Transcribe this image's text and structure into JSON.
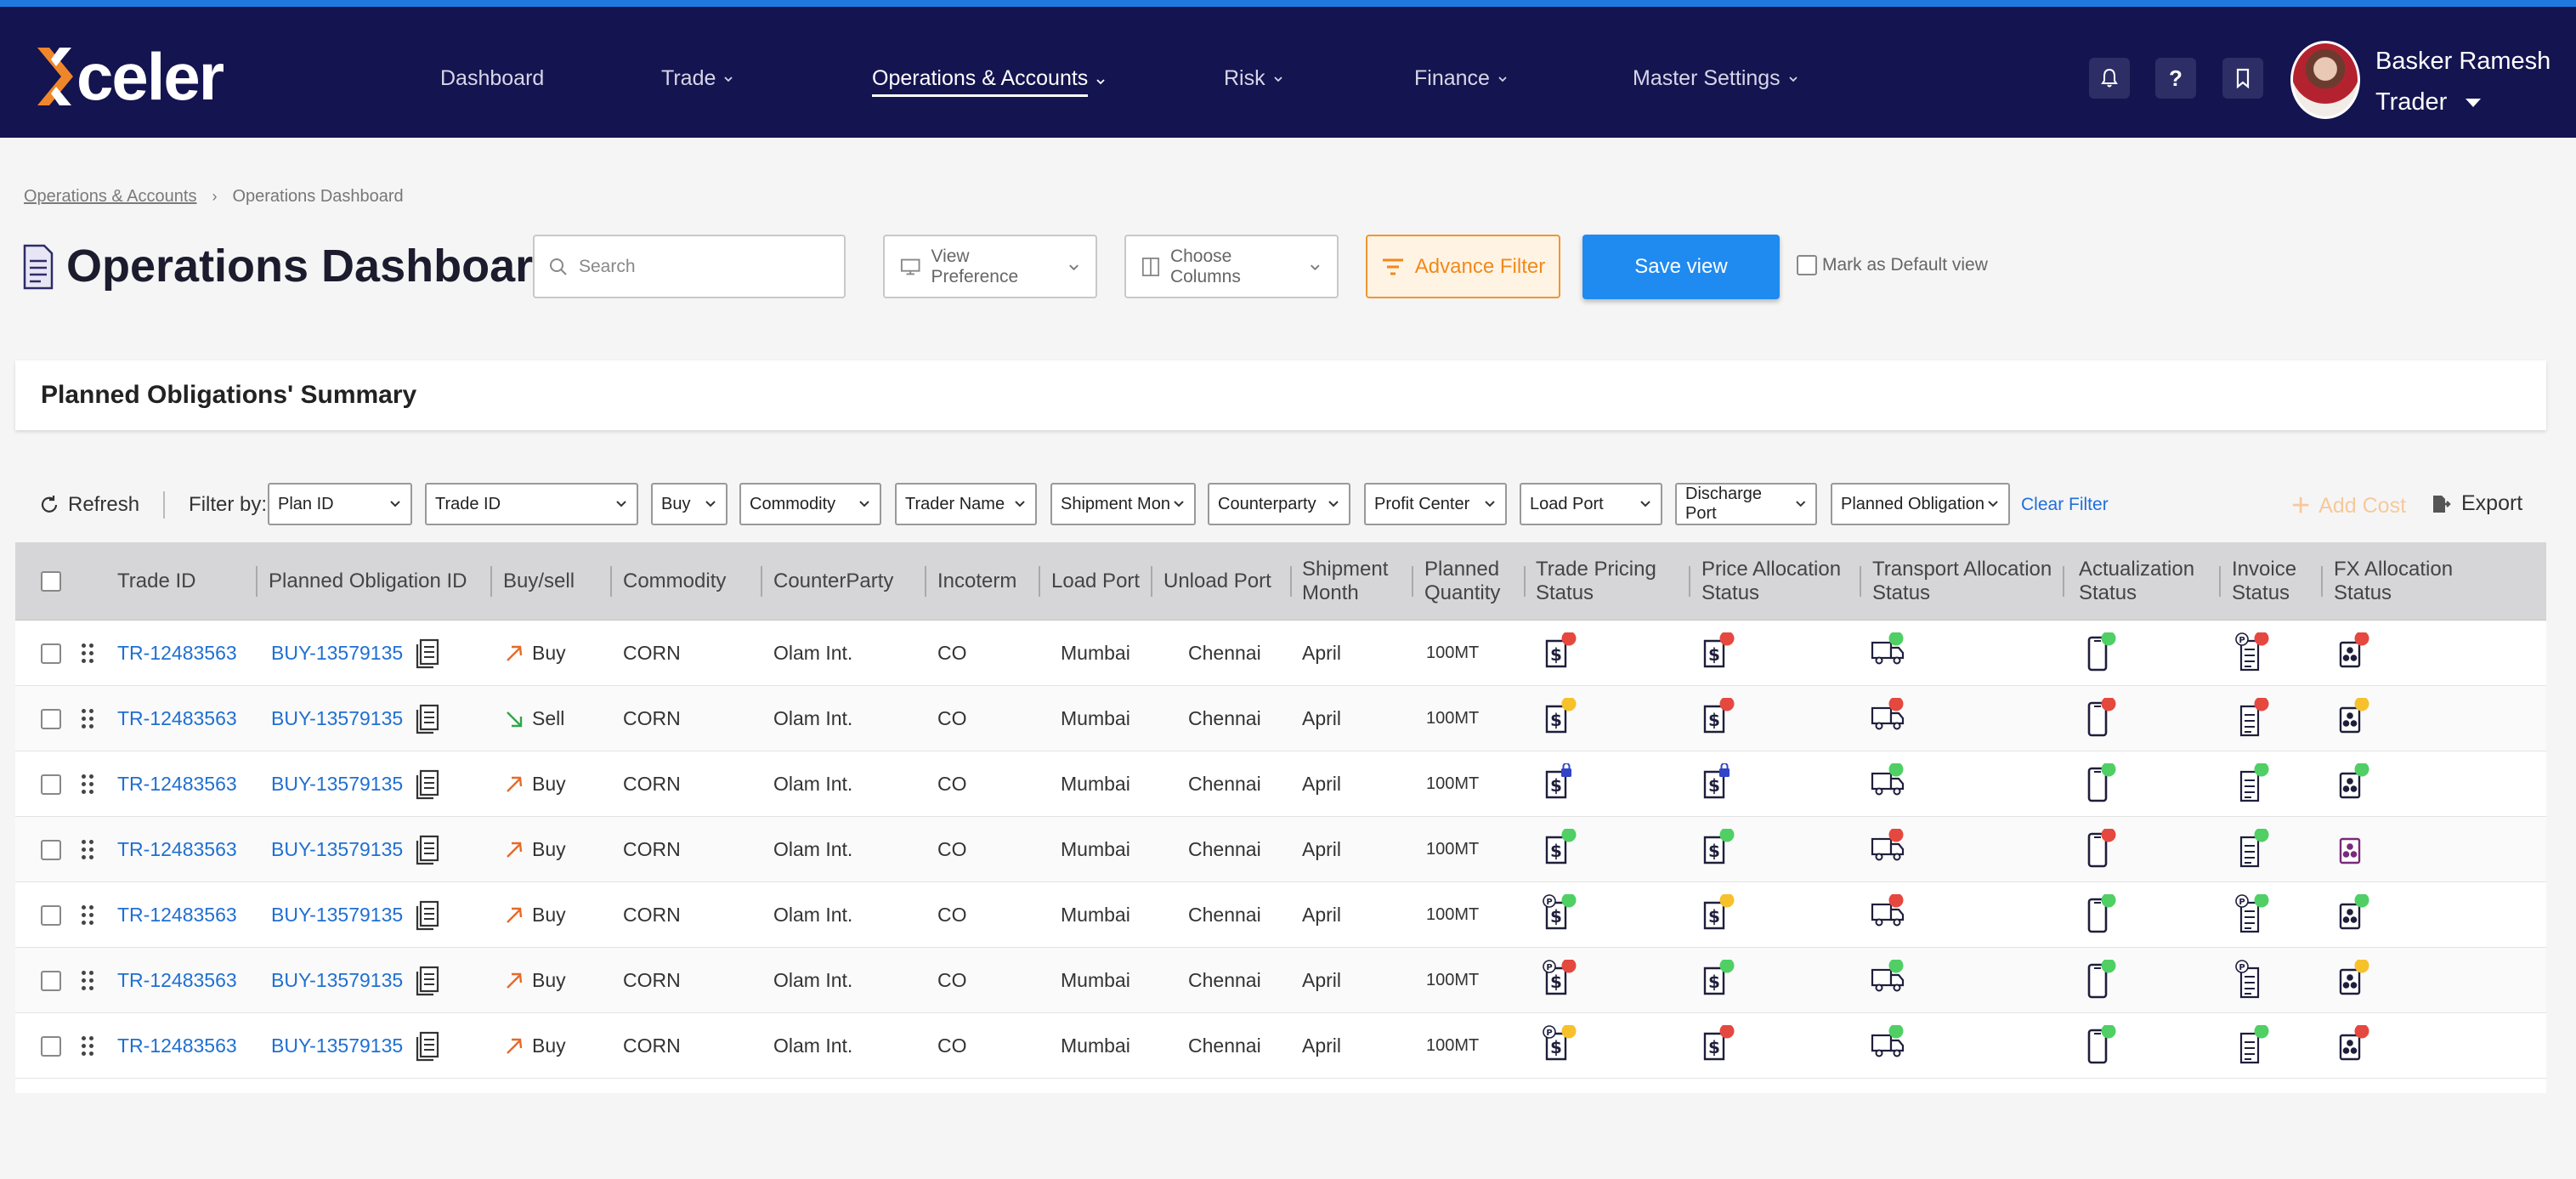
{
  "app": {
    "logo_text": "celer"
  },
  "nav": {
    "items": [
      {
        "label": "Dashboard",
        "has_menu": false
      },
      {
        "label": "Trade",
        "has_menu": true
      },
      {
        "label": "Operations & Accounts",
        "has_menu": true,
        "active": true
      },
      {
        "label": "Risk",
        "has_menu": true
      },
      {
        "label": "Finance",
        "has_menu": true
      },
      {
        "label": "Master Settings",
        "has_menu": true
      }
    ]
  },
  "user": {
    "name": "Basker Ramesh",
    "role": "Trader"
  },
  "breadcrumb": {
    "parent": "Operations & Accounts",
    "current": "Operations Dashboard"
  },
  "page": {
    "title": "Operations Dashboard"
  },
  "toolbar": {
    "search_placeholder": "Search",
    "view_preference": "View Preference",
    "choose_columns": "Choose Columns",
    "advance_filter": "Advance Filter",
    "save_view": "Save view",
    "mark_default": "Mark as Default view"
  },
  "summary": {
    "title": "Planned Obligations' Summary"
  },
  "filters": {
    "refresh": "Refresh",
    "label": "Filter by:",
    "selects": [
      "Plan ID",
      "Trade ID",
      "Buy",
      "Commodity",
      "Trader Name",
      "Shipment Mon",
      "Counterparty",
      "Profit Center",
      "Load Port",
      "Discharge Port",
      "Planned Obligation"
    ],
    "clear": "Clear Filter",
    "add_cost": "Add Cost",
    "export": "Export"
  },
  "table": {
    "headers": {
      "trade_id": "Trade ID",
      "po_id": "Planned Obligation ID",
      "buy_sell": "Buy/sell",
      "commodity": "Commodity",
      "counterparty": "CounterParty",
      "incoterm": "Incoterm",
      "load_port": "Load Port",
      "unload_port": "Unload Port",
      "shipment_month_1": "Shipment",
      "shipment_month_2": "Month",
      "planned_qty_1": "Planned",
      "planned_qty_2": "Quantity",
      "trade_pricing_1": "Trade Pricing",
      "trade_pricing_2": "Status",
      "price_alloc_1": "Price Allocation",
      "price_alloc_2": "Status",
      "transport_alloc_1": "Transport Allocation",
      "transport_alloc_2": "Status",
      "actualization_1": "Actualization",
      "actualization_2": "Status",
      "invoice_1": "Invoice",
      "invoice_2": "Status",
      "fx_alloc_1": "FX Allocation",
      "fx_alloc_2": "Status"
    },
    "status_colors": {
      "red": "#e5483f",
      "green": "#4fcf64",
      "yellow": "#f6c12b"
    },
    "rows": [
      {
        "trade_id": "TR-12483563",
        "po_id": "BUY-13579135",
        "side": "Buy",
        "commodity": "CORN",
        "counterparty": "Olam Int.",
        "incoterm": "CO",
        "load_port": "Mumbai",
        "unload_port": "Chennai",
        "month": "April",
        "qty": "100MT",
        "trade_pricing": "red",
        "price_alloc": "red",
        "transport": "green",
        "actualization": "green",
        "invoice": "red",
        "invoice_p": true,
        "fx": "red",
        "tp_p": false,
        "tp_lock": false,
        "pa_lock": false
      },
      {
        "trade_id": "TR-12483563",
        "po_id": "BUY-13579135",
        "side": "Sell",
        "commodity": "CORN",
        "counterparty": "Olam Int.",
        "incoterm": "CO",
        "load_port": "Mumbai",
        "unload_port": "Chennai",
        "month": "April",
        "qty": "100MT",
        "trade_pricing": "yellow",
        "price_alloc": "red",
        "transport": "red",
        "actualization": "red",
        "invoice": "red",
        "invoice_p": false,
        "fx": "yellow",
        "tp_p": false,
        "tp_lock": false,
        "pa_lock": false
      },
      {
        "trade_id": "TR-12483563",
        "po_id": "BUY-13579135",
        "side": "Buy",
        "commodity": "CORN",
        "counterparty": "Olam Int.",
        "incoterm": "CO",
        "load_port": "Mumbai",
        "unload_port": "Chennai",
        "month": "April",
        "qty": "100MT",
        "trade_pricing": "lock",
        "price_alloc": "lock",
        "transport": "green",
        "actualization": "green",
        "invoice": "green",
        "invoice_p": false,
        "fx": "green",
        "tp_p": false,
        "tp_lock": true,
        "pa_lock": true
      },
      {
        "trade_id": "TR-12483563",
        "po_id": "BUY-13579135",
        "side": "Buy",
        "commodity": "CORN",
        "counterparty": "Olam Int.",
        "incoterm": "CO",
        "load_port": "Mumbai",
        "unload_port": "Chennai",
        "month": "April",
        "qty": "100MT",
        "trade_pricing": "green",
        "price_alloc": "green",
        "transport": "red",
        "actualization": "red",
        "invoice": "green",
        "invoice_p": false,
        "fx": "none",
        "tp_p": false,
        "tp_lock": false,
        "pa_lock": false
      },
      {
        "trade_id": "TR-12483563",
        "po_id": "BUY-13579135",
        "side": "Buy",
        "commodity": "CORN",
        "counterparty": "Olam Int.",
        "incoterm": "CO",
        "load_port": "Mumbai",
        "unload_port": "Chennai",
        "month": "April",
        "qty": "100MT",
        "trade_pricing": "green",
        "price_alloc": "yellow",
        "transport": "red",
        "actualization": "green",
        "invoice": "green",
        "invoice_p": true,
        "fx": "green",
        "tp_p": true,
        "tp_lock": false,
        "pa_lock": false
      },
      {
        "trade_id": "TR-12483563",
        "po_id": "BUY-13579135",
        "side": "Buy",
        "commodity": "CORN",
        "counterparty": "Olam Int.",
        "incoterm": "CO",
        "load_port": "Mumbai",
        "unload_port": "Chennai",
        "month": "April",
        "qty": "100MT",
        "trade_pricing": "red",
        "price_alloc": "green",
        "transport": "green",
        "actualization": "green",
        "invoice": "none",
        "invoice_p": true,
        "fx": "yellow",
        "tp_p": true,
        "tp_lock": false,
        "pa_lock": false
      },
      {
        "trade_id": "TR-12483563",
        "po_id": "BUY-13579135",
        "side": "Buy",
        "commodity": "CORN",
        "counterparty": "Olam Int.",
        "incoterm": "CO",
        "load_port": "Mumbai",
        "unload_port": "Chennai",
        "month": "April",
        "qty": "100MT",
        "trade_pricing": "yellow",
        "price_alloc": "red",
        "transport": "green",
        "actualization": "green",
        "invoice": "green",
        "invoice_p": false,
        "fx": "red",
        "tp_p": true,
        "tp_lock": false,
        "pa_lock": false
      }
    ]
  },
  "icons": {
    "notifications": "bell-icon",
    "help": "question-icon",
    "bookmark": "bookmark-icon",
    "page": "document-icon",
    "search": "search-icon",
    "view_preference": "monitor-icon",
    "choose_columns": "columns-icon",
    "advance_filter": "filter-icon",
    "refresh": "refresh-icon",
    "export": "export-icon",
    "add_cost": "plus-icon"
  }
}
